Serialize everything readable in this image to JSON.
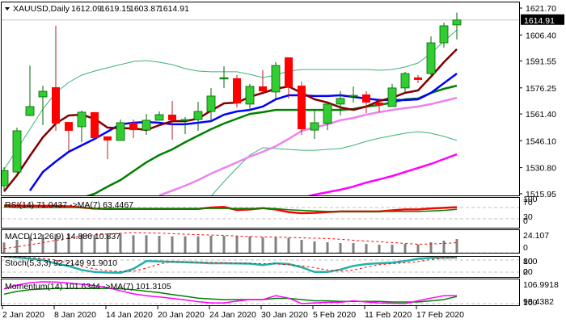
{
  "header": {
    "symbol_tf": "XAUUSD,Daily",
    "open": "1612.09",
    "high": "1619.15",
    "low": "1603.87",
    "close": "1614.91"
  },
  "price_axis": {
    "labels": [
      "1621.70",
      "1606.40",
      "1591.55",
      "1576.25",
      "1561.40",
      "1546.10",
      "1530.80",
      "1515.95"
    ],
    "current": "1614.91"
  },
  "x_axis": [
    {
      "label": "2 Jan 2020",
      "index": 0
    },
    {
      "label": "8 Jan 2020",
      "index": 4
    },
    {
      "label": "14 Jan 2020",
      "index": 8
    },
    {
      "label": "20 Jan 2020",
      "index": 12
    },
    {
      "label": "24 Jan 2020",
      "index": 16
    },
    {
      "label": "30 Jan 2020",
      "index": 20
    },
    {
      "label": "5 Feb 2020",
      "index": 24
    },
    {
      "label": "11 Feb 2020",
      "index": 28
    },
    {
      "label": "17 Feb 2020",
      "index": 32
    }
  ],
  "colors": {
    "bull": "#32cd32",
    "bear": "#ff0000",
    "bull_edge": "#006400",
    "bear_edge": "#b22222",
    "ma_fast": "#800000",
    "ma_blue": "#0000ff",
    "ma_green": "#008000",
    "ma_violet": "#ee82ee",
    "ma_magenta": "#ff00ff",
    "bands": "#3cb371",
    "rsi": "#ff0000",
    "rsi_ma": "#008000",
    "macd_hist": "#808080",
    "signal": "#ff0000",
    "stoch": "#20b2aa",
    "mom": "#ff00ff",
    "mom_ma": "#008000"
  },
  "panels": {
    "rsi": {
      "label": "RSI(14) 71.0437 ->MA(7) 63.4467",
      "levels": [
        "100",
        "70",
        "30",
        "0"
      ]
    },
    "macd": {
      "label": "MACD(12,26,9) 14.886 10.837",
      "levels": [
        "24.107",
        "0"
      ]
    },
    "stoch": {
      "label": "Stoch(5,3,3) 92.2149 91.9010",
      "levels": [
        "100",
        "80",
        "20",
        "0"
      ]
    },
    "momentum": {
      "label": "Momentum(14) 101.6344 ->MA(7) 101.3105",
      "levels": [
        "106.9918",
        "100",
        "98.4382"
      ]
    }
  },
  "chart_data": [
    {
      "type": "candlestick",
      "title": "XAUUSD,Daily",
      "ylim": [
        1515.95,
        1621.7
      ],
      "ohlc": [
        [
          1520.5,
          1531.1,
          1517.7,
          1529.2
        ],
        [
          1528.3,
          1553.6,
          1527.9,
          1551.8
        ],
        [
          1560.5,
          1589.0,
          1560.1,
          1565.6
        ],
        [
          1571.1,
          1577.5,
          1555.0,
          1574.3
        ],
        [
          1576.6,
          1611.6,
          1551.8,
          1555.9
        ],
        [
          1556.8,
          1556.8,
          1540.3,
          1551.8
        ],
        [
          1554.1,
          1563.3,
          1545.3,
          1562.4
        ],
        [
          1562.4,
          1562.4,
          1547.6,
          1547.6
        ],
        [
          1548.6,
          1548.6,
          1535.7,
          1546.3
        ],
        [
          1546.3,
          1558.2,
          1546.3,
          1556.4
        ],
        [
          1556.4,
          1558.2,
          1547.6,
          1552.2
        ],
        [
          1552.2,
          1561.4,
          1549.5,
          1557.8
        ],
        [
          1557.8,
          1562.8,
          1557.8,
          1561.0
        ],
        [
          1561.0,
          1568.8,
          1546.7,
          1557.8
        ],
        [
          1557.8,
          1559.6,
          1549.9,
          1558.2
        ],
        [
          1558.2,
          1568.3,
          1551.8,
          1562.8
        ],
        [
          1562.8,
          1576.2,
          1556.8,
          1571.6
        ],
        [
          1581.5,
          1588.6,
          1576.2,
          1582.0
        ],
        [
          1581.7,
          1583.5,
          1565.1,
          1567.4
        ],
        [
          1567.0,
          1578.5,
          1563.3,
          1577.1
        ],
        [
          1577.1,
          1586.3,
          1572.5,
          1574.3
        ],
        [
          1573.9,
          1590.9,
          1570.2,
          1589.0
        ],
        [
          1593.6,
          1593.6,
          1570.2,
          1576.6
        ],
        [
          1577.5,
          1579.8,
          1549.5,
          1552.7
        ],
        [
          1552.2,
          1563.3,
          1547.2,
          1556.4
        ],
        [
          1556.0,
          1567.0,
          1552.2,
          1567.0
        ],
        [
          1567.0,
          1574.3,
          1560.5,
          1570.2
        ],
        [
          1571.8,
          1577.1,
          1567.9,
          1572.0
        ],
        [
          1572.5,
          1574.3,
          1561.9,
          1567.9
        ],
        [
          1567.9,
          1570.2,
          1562.4,
          1566.5
        ],
        [
          1565.6,
          1578.5,
          1565.6,
          1576.2
        ],
        [
          1576.2,
          1585.4,
          1573.4,
          1584.4
        ],
        [
          1582.2,
          1583.5,
          1578.9,
          1580.8
        ],
        [
          1584.4,
          1605.6,
          1582.6,
          1601.9
        ],
        [
          1601.9,
          1613.4,
          1599.2,
          1611.6
        ],
        [
          1612.09,
          1619.15,
          1603.87,
          1614.91
        ]
      ],
      "overlays": {
        "ma_fast": [
          1517.3,
          1526.5,
          1537.5,
          1548.1,
          1555.9,
          1560.5,
          1561.0,
          1558.7,
          1553.6,
          1553.2,
          1553.2,
          1552.2,
          1555.0,
          1557.3,
          1557.3,
          1558.7,
          1563.3,
          1567.4,
          1567.9,
          1571.1,
          1573.4,
          1575.7,
          1577.1,
          1573.4,
          1569.7,
          1567.9,
          1565.1,
          1563.7,
          1565.6,
          1568.8,
          1570.6,
          1573.4,
          1574.8,
          1582.6,
          1590.9,
          1598.3
        ],
        "ma_blue": [
          null,
          null,
          1517.7,
          1528.3,
          1534.3,
          1539.8,
          1543.5,
          1547.2,
          1551.3,
          1555.5,
          1556.4,
          1556.8,
          1556.4,
          1555.5,
          1555.5,
          1556.4,
          1557.3,
          1561.0,
          1562.8,
          1563.7,
          1565.6,
          1569.7,
          1572.0,
          1572.0,
          1571.6,
          1571.6,
          1572.0,
          1571.1,
          1570.2,
          1569.3,
          1569.3,
          1569.3,
          1569.7,
          1573.4,
          1578.9,
          1584.4
        ],
        "ma_green": [
          null,
          null,
          null,
          null,
          null,
          null,
          1513.6,
          1515.9,
          1520.0,
          1523.7,
          1528.8,
          1533.8,
          1538.0,
          1541.2,
          1545.3,
          1549.0,
          1552.7,
          1555.9,
          1558.7,
          1561.4,
          1562.4,
          1563.7,
          1563.7,
          1563.7,
          1563.7,
          1563.7,
          1563.7,
          1564.2,
          1565.6,
          1566.5,
          1567.9,
          1569.7,
          1570.2,
          1573.4,
          1575.7,
          1577.5
        ],
        "ma_violet": [
          null,
          null,
          null,
          null,
          null,
          null,
          null,
          null,
          null,
          null,
          null,
          null,
          1515.0,
          1517.7,
          1520.5,
          1523.7,
          1527.4,
          1530.6,
          1533.8,
          1537.1,
          1539.8,
          1543.0,
          1547.2,
          1551.8,
          1553.6,
          1555.5,
          1557.8,
          1559.1,
          1561.0,
          1562.4,
          1563.7,
          1564.7,
          1565.6,
          1567.0,
          1568.8,
          1570.6
        ],
        "ma_magenta": [
          null,
          null,
          null,
          null,
          null,
          null,
          null,
          null,
          null,
          null,
          null,
          null,
          null,
          null,
          null,
          null,
          null,
          null,
          null,
          null,
          null,
          null,
          null,
          1513.6,
          1515.4,
          1516.8,
          1518.2,
          1520.0,
          1522.3,
          1524.1,
          1526.0,
          1528.3,
          1530.6,
          1532.9,
          1535.7,
          1538.4
        ],
        "bb_upper": [
          1529.7,
          1541.2,
          1552.7,
          1564.2,
          1573.4,
          1579.4,
          1583.5,
          1585.8,
          1587.7,
          1589.5,
          1591.3,
          1591.8,
          1590.9,
          1589.5,
          1587.2,
          1585.8,
          1585.4,
          1585.4,
          1585.4,
          1584.0,
          1582.1,
          1583.5,
          1585.8,
          1586.7,
          1586.7,
          1586.7,
          1586.7,
          1586.7,
          1586.7,
          1586.3,
          1586.7,
          1588.1,
          1590.4,
          1595.9,
          1602.8,
          1609.3
        ],
        "bb_lower": [
          null,
          null,
          null,
          null,
          null,
          null,
          null,
          null,
          null,
          null,
          null,
          null,
          null,
          null,
          null,
          null,
          1514.5,
          1522.8,
          1530.6,
          1538.0,
          1542.1,
          1541.7,
          1541.2,
          1540.7,
          1540.7,
          1541.2,
          1541.7,
          1543.5,
          1545.8,
          1547.6,
          1549.0,
          1550.4,
          1551.3,
          1550.4,
          1548.6,
          1546.3
        ]
      }
    },
    {
      "type": "line",
      "title": "RSI(14)",
      "ylim": [
        0,
        100
      ],
      "levels": [
        70,
        30
      ],
      "series": [
        {
          "name": "RSI",
          "values": [
            77,
            77,
            76,
            76,
            76,
            74,
            70,
            66,
            65,
            65,
            65,
            65,
            65,
            65,
            65,
            65,
            70,
            72,
            61,
            63,
            68,
            63,
            54,
            50,
            51,
            54,
            56,
            56,
            56,
            56,
            60,
            63,
            63,
            67,
            69,
            71.04
          ]
        },
        {
          "name": "MA(7)",
          "values": [
            72,
            70,
            70,
            70,
            70,
            70,
            70,
            67,
            67,
            67,
            67,
            67,
            67,
            67,
            67,
            67,
            67,
            67,
            67,
            67,
            67,
            66,
            62,
            60,
            58,
            56,
            56,
            56,
            56,
            56,
            56,
            56,
            56,
            58,
            60,
            63.45
          ]
        }
      ]
    },
    {
      "type": "bar",
      "title": "MACD(12,26,9)",
      "ylim": [
        0,
        24.107
      ],
      "series": [
        {
          "name": "MACD",
          "values": [
            11.1,
            14.0,
            16.9,
            19.9,
            20.4,
            20.4,
            19.9,
            19.0,
            19.9,
            20.4,
            19.0,
            19.0,
            18.4,
            17.8,
            17.8,
            17.8,
            18.4,
            18.4,
            17.8,
            17.8,
            16.9,
            16.9,
            16.4,
            14.0,
            12.3,
            11.4,
            10.5,
            10.5,
            9.6,
            8.8,
            8.8,
            9.6,
            9.1,
            11.4,
            13.1,
            14.886
          ]
        },
        {
          "name": "Signal",
          "values": [
            4.4,
            6.5,
            8.7,
            11.0,
            13.5,
            15.8,
            18.4,
            19.5,
            20.4,
            21.1,
            21.9,
            21.6,
            21.3,
            20.8,
            20.1,
            19.6,
            19.2,
            18.8,
            18.1,
            17.6,
            17.2,
            17.0,
            16.6,
            16.2,
            15.8,
            15.4,
            14.6,
            13.6,
            12.7,
            12.0,
            11.0,
            10.1,
            9.3,
            9.5,
            10.2,
            10.837
          ]
        }
      ]
    },
    {
      "type": "line",
      "title": "Stoch(5,3,3)",
      "ylim": [
        0,
        100
      ],
      "levels": [
        80,
        20
      ],
      "series": [
        {
          "name": "%K",
          "values": [
            97,
            93,
            87,
            80,
            63,
            50,
            31,
            21,
            18,
            17,
            36,
            75,
            73,
            71,
            69,
            67,
            64,
            64,
            63,
            62,
            55,
            64,
            60,
            44,
            21,
            21,
            33,
            51,
            60,
            64,
            67,
            75,
            86,
            91,
            92,
            92.21
          ]
        },
        {
          "name": "%D",
          "values": [
            95,
            94,
            92,
            88,
            80,
            65,
            48,
            36,
            27,
            23,
            24,
            40,
            60,
            72,
            72,
            70,
            68,
            66,
            64,
            63,
            62,
            61,
            57,
            51,
            42,
            31,
            25,
            30,
            45,
            57,
            62,
            66,
            72,
            83,
            89,
            91.9
          ]
        }
      ]
    },
    {
      "type": "line",
      "title": "Momentum(14)",
      "ylim": [
        98.4382,
        106.9918
      ],
      "levels": [
        100
      ],
      "series": [
        {
          "name": "Momentum",
          "values": [
            103.8,
            105.1,
            105.9,
            106.2,
            106.1,
            105.8,
            105.4,
            104.9,
            104.3,
            103.2,
            102.2,
            101.6,
            101.2,
            100.7,
            100.2,
            99.6,
            99.2,
            99.2,
            99.8,
            100.3,
            100.3,
            101.6,
            100.8,
            99.0,
            99.2,
            99.4,
            99.4,
            99.9,
            99.5,
            99.2,
            99.1,
            99.0,
            99.9,
            100.8,
            101.6,
            101.63
          ]
        },
        {
          "name": "MA(7)",
          "values": [
            102.1,
            103.0,
            103.6,
            103.8,
            104.0,
            104.0,
            104.0,
            104.0,
            104.0,
            103.9,
            103.6,
            103.1,
            102.6,
            102.0,
            101.4,
            100.8,
            100.5,
            100.3,
            100.3,
            100.3,
            100.3,
            100.7,
            100.7,
            100.3,
            99.9,
            99.9,
            99.7,
            99.7,
            99.7,
            99.7,
            99.5,
            99.5,
            99.5,
            99.9,
            100.3,
            101.31
          ]
        }
      ]
    }
  ]
}
